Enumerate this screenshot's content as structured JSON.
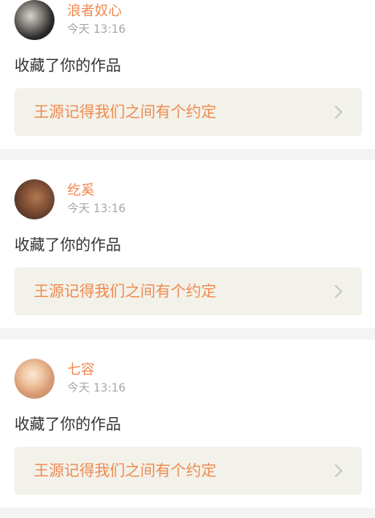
{
  "feed": {
    "items": [
      {
        "username": "浪者奴心",
        "time": "今天 13:16",
        "action": "收藏了你的作品",
        "work_title": "王源记得我们之间有个约定",
        "avatar_color": "#1a1a1a"
      },
      {
        "username": "纥奚",
        "time": "今天 13:16",
        "action": "收藏了你的作品",
        "work_title": "王源记得我们之间有个约定",
        "avatar_color": "#8a5638"
      },
      {
        "username": "七容",
        "time": "今天 13:16",
        "action": "收藏了你的作品",
        "work_title": "王源记得我们之间有个约定",
        "avatar_color": "#f1c7a4"
      }
    ]
  },
  "colors": {
    "accent": "#f0894f",
    "text_primary": "#333333",
    "text_secondary": "#a6a6a6",
    "box_bg": "#f3f2ea",
    "page_bg": "#f4f4f4"
  },
  "icons": {
    "chevron": "chevron-right-icon",
    "avatar": "user-avatar-image"
  }
}
